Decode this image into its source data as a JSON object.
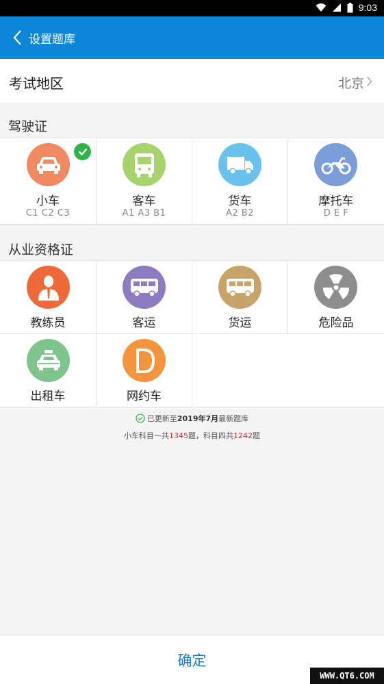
{
  "status_bar": {
    "time": "9:03"
  },
  "app_bar": {
    "title": "设置题库"
  },
  "region": {
    "label": "考试地区",
    "value": "北京"
  },
  "license_section": {
    "title": "驾驶证",
    "items": [
      {
        "label": "小车",
        "sub": "C1 C2 C3",
        "icon": "car-icon",
        "color": "#ef8a63",
        "selected": true
      },
      {
        "label": "客车",
        "sub": "A1 A3 B1",
        "icon": "bus-icon",
        "color": "#a7d36d",
        "selected": false
      },
      {
        "label": "货车",
        "sub": "A2 B2",
        "icon": "truck-icon",
        "color": "#68c2ec",
        "selected": false
      },
      {
        "label": "摩托车",
        "sub": "D E F",
        "icon": "motorcycle-icon",
        "color": "#7b9ed9",
        "selected": false
      }
    ]
  },
  "qualification_section": {
    "title": "从业资格证",
    "items": [
      {
        "label": "教练员",
        "icon": "coach-icon",
        "color": "#ef6a3a"
      },
      {
        "label": "客运",
        "icon": "passenger-bus-icon",
        "color": "#8e7cc3"
      },
      {
        "label": "货运",
        "icon": "cargo-bus-icon",
        "color": "#c9a46a"
      },
      {
        "label": "危险品",
        "icon": "radiation-icon",
        "color": "#8d8d8d"
      },
      {
        "label": "出租车",
        "icon": "taxi-icon",
        "color": "#7fc48b"
      },
      {
        "label": "网约车",
        "icon": "ride-hailing-icon",
        "color": "#f3953f"
      }
    ]
  },
  "update": {
    "prefix": "已更新至",
    "date": "2019年7月",
    "suffix": "最新题库",
    "line2_a": "小车科目一共",
    "count1": "1345",
    "line2_b": "题，科目四共",
    "count4": "1242",
    "line2_c": "题"
  },
  "confirm": {
    "label": "确定"
  },
  "watermark": {
    "text": "WWW.QT6.COM"
  }
}
